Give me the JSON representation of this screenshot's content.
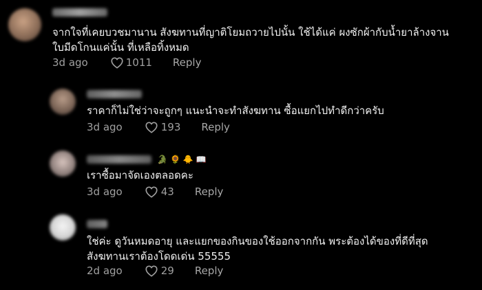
{
  "comments": [
    {
      "text_lines": [
        "จากใจที่เคยบวชมานาน สังฆทานที่ญาติโยมถวายไปนั้น ใช้ได้แค่ ผงซักผ้ากับน้ำยาล้างจาน",
        "ใบมีดโกนแค่นั้น ที่เหลือทิ้งหมด"
      ],
      "time": "3d ago",
      "likes": "1011",
      "reply_label": "Reply"
    },
    {
      "text_lines": [
        "ราคาก็ไม่ใช่ว่าจะถูกๆ แนะนำจะทำสังฆทาน ซื้อแยกไปทำดีกว่าครับ"
      ],
      "time": "3d ago",
      "likes": "193",
      "reply_label": "Reply"
    },
    {
      "text_lines": [
        "เราซื้อมาจัดเองตลอดคะ"
      ],
      "time": "3d ago",
      "likes": "43",
      "reply_label": "Reply",
      "name_emojis": [
        "🐊",
        "🌻",
        "🐥",
        "📖"
      ]
    },
    {
      "text_lines": [
        "ใช่ค่ะ ดูวันหมดอายุ และแยกของกินของใช้ออกจากกัน พระต้องได้ของที่ดีที่สุด",
        "สังฆทานเราต้องโดดเด่น 55555"
      ],
      "time": "2d ago",
      "likes": "29",
      "reply_label": "Reply"
    }
  ],
  "icons": {
    "like": "heart-outline-icon"
  },
  "colors": {
    "background": "#000000",
    "text": "#f1f1f1",
    "meta": "#a0a0a0"
  }
}
